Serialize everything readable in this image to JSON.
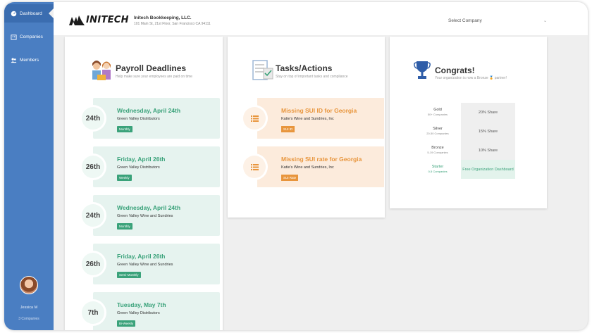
{
  "sidebar": {
    "items": [
      {
        "label": "Dashboard",
        "icon": "dashboard-icon"
      },
      {
        "label": "Companies",
        "icon": "building-icon"
      },
      {
        "label": "Members",
        "icon": "people-icon"
      }
    ],
    "user": {
      "name": "Jessica M",
      "sub": "3 Companies"
    }
  },
  "header": {
    "logo_text": "INITECH",
    "company_name": "Initech Bookkeeping, LLC.",
    "company_address": "101 Main St, 21st Floor, San Francisco CA 94111",
    "select_company": "Select Company"
  },
  "payroll": {
    "title": "Payroll Deadlines",
    "subtitle": "Help make sure your employees are paid on time",
    "items": [
      {
        "day": "24th",
        "date": "Wednesday, April 24th",
        "client": "Green Valley Distributors",
        "freq": "Monthly"
      },
      {
        "day": "26th",
        "date": "Friday, April 26th",
        "client": "Green Valley Distributors",
        "freq": "Weekly"
      },
      {
        "day": "24th",
        "date": "Wednesday, April 24th",
        "client": "Green Valley Wine and Sundries",
        "freq": "Monthly"
      },
      {
        "day": "26th",
        "date": "Friday, April 26th",
        "client": "Green Valley Wine and Sundries",
        "freq": "Semi-Monthly"
      },
      {
        "day": "7th",
        "date": "Tuesday, May 7th",
        "client": "Green Valley Distributors",
        "freq": "Bi-Weekly"
      }
    ]
  },
  "tasks": {
    "title": "Tasks/Actions",
    "subtitle": "Stay on top of important tasks and compliance",
    "items": [
      {
        "title": "Missing SUI ID for Georgia",
        "client": "Katie's Wine and Sundries, Inc",
        "tag": "SUI ID"
      },
      {
        "title": "Missing SUI rate for Georgia",
        "client": "Katie's Wine and Sundries, Inc",
        "tag": "SUI Rate"
      }
    ]
  },
  "congrats": {
    "title": "Congrats!",
    "subtitle": "Your organization is now a Bronze",
    "subtitle_end": "partner!",
    "tiers": [
      {
        "name": "Gold",
        "count": "50+ Companies",
        "reward": "20% Share"
      },
      {
        "name": "Silver",
        "count": "20-50 Companies",
        "reward": "15% Share"
      },
      {
        "name": "Bronze",
        "count": "5-19 Companies",
        "reward": "10% Share"
      },
      {
        "name": "Starter",
        "count": "0-5 Companies",
        "reward": "Free Organization Dashboard"
      }
    ]
  },
  "colors": {
    "sidebar": "#4a7ec2",
    "green": "#3aa27a",
    "orange": "#e8953c"
  }
}
